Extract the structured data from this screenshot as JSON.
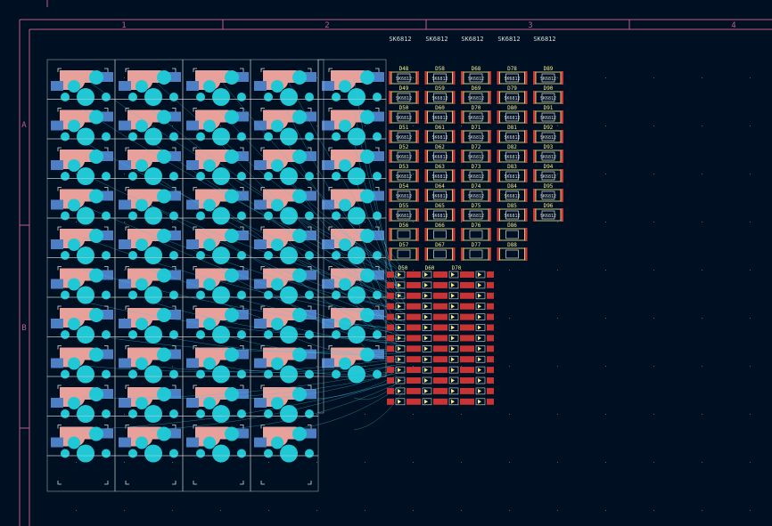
{
  "colors": {
    "background": "#001023",
    "frame": "#c05a8a",
    "silkscreen": "#d8dcd8",
    "ref_text": "#f2eb8a",
    "copper_front": "#c83434",
    "copper_back": "#4d7fc4",
    "pad_cyan": "#1fc8d4",
    "courtyard": "#e8a09a",
    "ratsnest": "#3cc8e8",
    "grid_dot": "#54606c"
  },
  "frame": {
    "column_labels": [
      "1",
      "2",
      "3",
      "4"
    ],
    "row_labels": [
      "A",
      "B"
    ]
  },
  "switch_matrix": {
    "columns": 5,
    "rows": 10,
    "last_column_rows": 8,
    "footprint": "mx-switch-hotswap"
  },
  "leds": {
    "header_labels": [
      "SK6812",
      "SK6812",
      "SK6812",
      "SK6812",
      "SK6812"
    ],
    "columns": [
      {
        "refs": [
          "D48",
          "D49",
          "D50",
          "D51",
          "D52",
          "D53",
          "D54",
          "D55",
          "D56",
          "D57"
        ]
      },
      {
        "refs": [
          "D58",
          "D59",
          "D60",
          "D61",
          "D62",
          "D63",
          "D64",
          "D65",
          "D66",
          "D67"
        ]
      },
      {
        "refs": [
          "D68",
          "D69",
          "D70",
          "D71",
          "D72",
          "D73",
          "D74",
          "D75",
          "D76",
          "D77"
        ]
      },
      {
        "refs": [
          "D78",
          "D79",
          "D80",
          "D81",
          "D82",
          "D83",
          "D84",
          "D85",
          "D86",
          "D88"
        ]
      },
      {
        "refs": [
          "D89",
          "D90",
          "D91",
          "D92",
          "D93",
          "D94",
          "D95",
          "D96"
        ]
      }
    ],
    "body_label": "SK6812"
  },
  "diodes": {
    "columns": 4,
    "rows": 13,
    "header_refs": [
      "D50",
      "D60",
      "D70",
      ""
    ]
  }
}
